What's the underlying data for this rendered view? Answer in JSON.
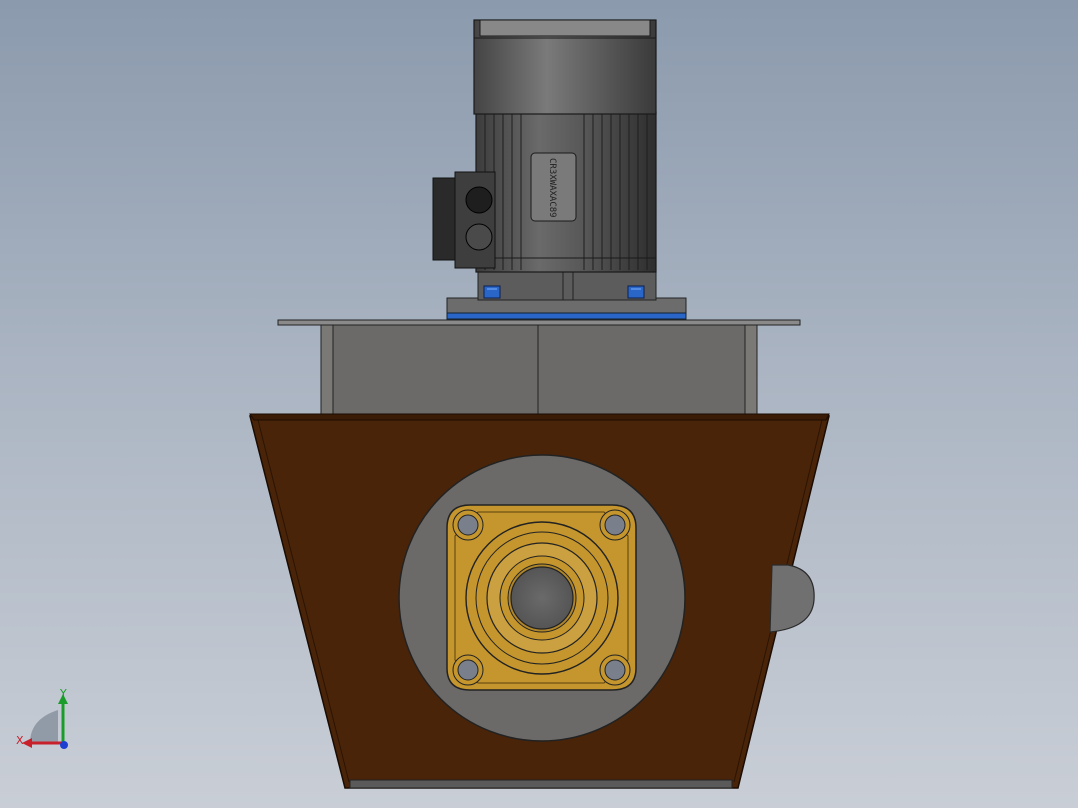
{
  "nameplate": {
    "text": "CR3XWAXAC89"
  },
  "triad": {
    "x_label": "X",
    "y_label": "Y"
  },
  "colors": {
    "background_top": "#8b9aad",
    "background_bottom": "#c9ced6",
    "hopper": "#4a2408",
    "steel": "#6b6a68",
    "motor": "#5a5a5a",
    "bearing": "#c4962d",
    "bolt_blue": "#2a66c8"
  }
}
